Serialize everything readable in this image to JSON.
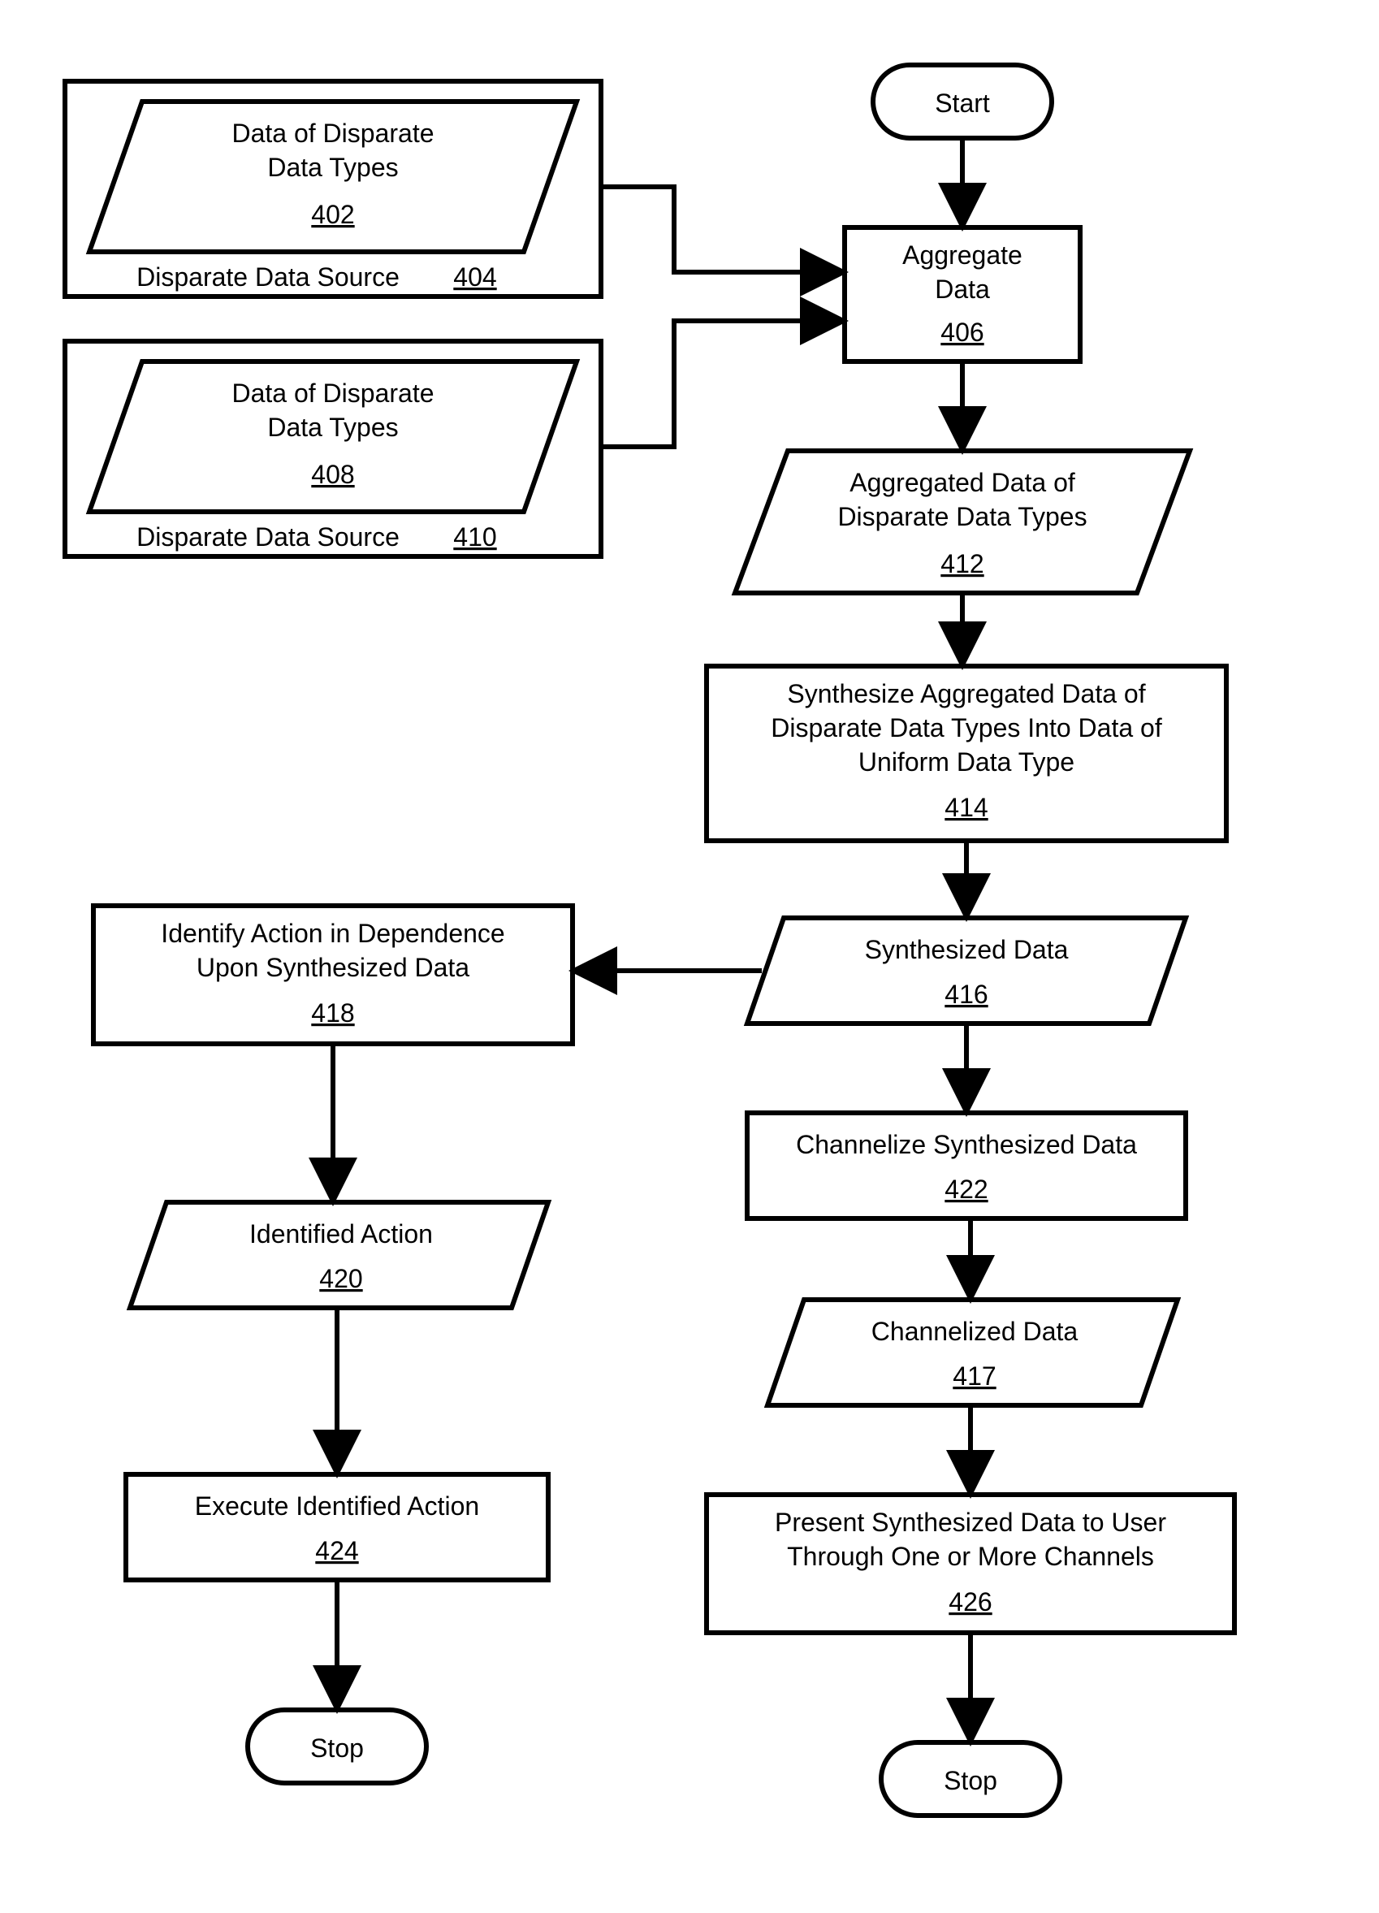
{
  "terminals": {
    "start": "Start",
    "stop": "Stop"
  },
  "nodes": {
    "n402": {
      "l1": "Data of Disparate",
      "l2": "Data Types",
      "ref": "402"
    },
    "n404": {
      "l1": "Disparate Data Source",
      "ref": "404"
    },
    "n408": {
      "l1": "Data of Disparate",
      "l2": "Data Types",
      "ref": "408"
    },
    "n410": {
      "l1": "Disparate Data Source",
      "ref": "410"
    },
    "n406": {
      "l1": "Aggregate",
      "l2": "Data",
      "ref": "406"
    },
    "n412": {
      "l1": "Aggregated Data of",
      "l2": "Disparate Data Types",
      "ref": "412"
    },
    "n414": {
      "l1": "Synthesize Aggregated Data of",
      "l2": "Disparate Data Types Into Data of",
      "l3": "Uniform Data Type",
      "ref": "414"
    },
    "n416": {
      "l1": "Synthesized Data",
      "ref": "416"
    },
    "n418": {
      "l1": "Identify Action in Dependence",
      "l2": "Upon Synthesized Data",
      "ref": "418"
    },
    "n420": {
      "l1": "Identified Action",
      "ref": "420"
    },
    "n422": {
      "l1": "Channelize Synthesized Data",
      "ref": "422"
    },
    "n417": {
      "l1": "Channelized Data",
      "ref": "417"
    },
    "n424": {
      "l1": "Execute Identified Action",
      "ref": "424"
    },
    "n426": {
      "l1": "Present Synthesized Data to User",
      "l2": "Through One or More Channels",
      "ref": "426"
    }
  }
}
